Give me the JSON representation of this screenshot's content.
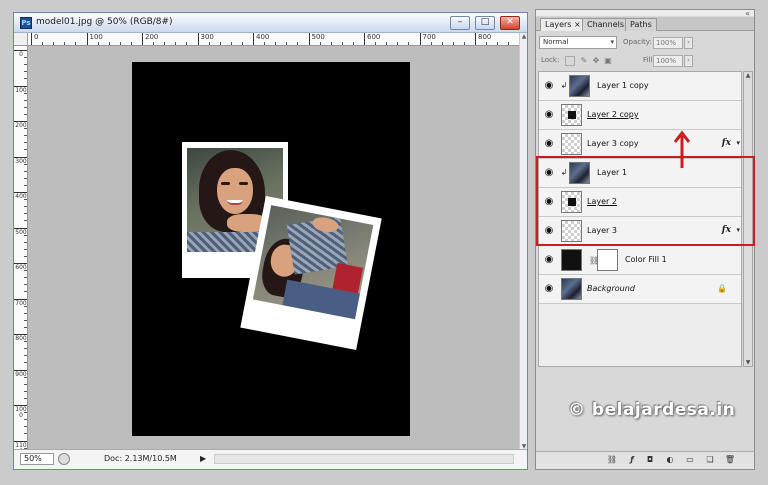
{
  "document": {
    "title": "model01.jpg @ 50% (RGB/8#)",
    "ruler_labels": [
      "0",
      "100",
      "200",
      "300",
      "400",
      "500",
      "600",
      "700",
      "800",
      "900"
    ],
    "vertical_ruler_labels": [
      "0",
      "100",
      "200",
      "300",
      "400",
      "500",
      "600",
      "700",
      "800",
      "900",
      "1000",
      "1100"
    ],
    "zoom": "50%",
    "doc_info": "Doc: 2.13M/10.5M",
    "status_arrow": "▶"
  },
  "panel": {
    "tabs": [
      "Layers ×",
      "Channels",
      "Paths"
    ],
    "blend_mode": "Normal",
    "opacity_label": "Opacity:",
    "opacity_value": "100%",
    "lock_label": "Lock:",
    "fill_label": "Fill:",
    "fill_value": "100%",
    "layers": [
      {
        "name": "Layer 1 copy",
        "thumb": "photo",
        "clipped": true,
        "style": "",
        "fx": false
      },
      {
        "name": "Layer 2 copy",
        "thumb": "mask",
        "clipped": false,
        "style": "under",
        "fx": false
      },
      {
        "name": "Layer 3 copy",
        "thumb": "checker",
        "clipped": false,
        "style": "",
        "fx": true
      },
      {
        "name": "Layer 1",
        "thumb": "photo",
        "clipped": true,
        "style": "",
        "fx": false
      },
      {
        "name": "Layer 2",
        "thumb": "mask",
        "clipped": false,
        "style": "under",
        "fx": false
      },
      {
        "name": "Layer 3",
        "thumb": "checker",
        "clipped": false,
        "style": "",
        "fx": true
      },
      {
        "name": "Color Fill 1",
        "thumb": "colorfill",
        "clipped": false,
        "style": "",
        "fx": false
      },
      {
        "name": "Background",
        "thumb": "photo",
        "clipped": false,
        "style": "ital",
        "fx": false,
        "locked": true
      }
    ],
    "fx_label": "fx"
  },
  "watermark": "© belajardesa.in",
  "colors": {
    "highlight": "#c81e1e",
    "canvas": "#000000",
    "workspace": "#bdbdbd"
  }
}
